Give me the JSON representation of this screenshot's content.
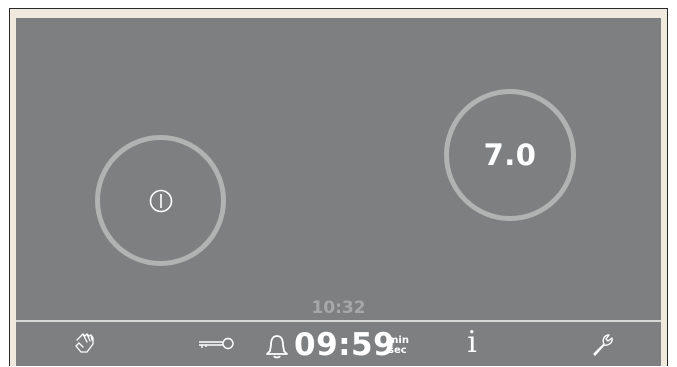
{
  "cooktop": {
    "zones": [
      {
        "id": "left",
        "state": "off",
        "display_icon": "power-icon"
      },
      {
        "id": "right",
        "state": "on",
        "level": "7.0"
      }
    ],
    "clock": "10:32",
    "timer": {
      "value": "09:59",
      "unit_top": "min",
      "unit_bottom": "sec",
      "icon": "bell-icon"
    },
    "bottom_bar": {
      "wipe_protection_icon": "hand-wipe-icon",
      "lock_icon": "key-icon",
      "info_label": "i",
      "settings_icon": "wrench-icon"
    },
    "colors": {
      "panel": "#7d7f80",
      "zone_ring": "#b1b3b2",
      "text": "#ffffff",
      "clock_text": "#a6a8a8",
      "frame": "#efeadd"
    }
  }
}
